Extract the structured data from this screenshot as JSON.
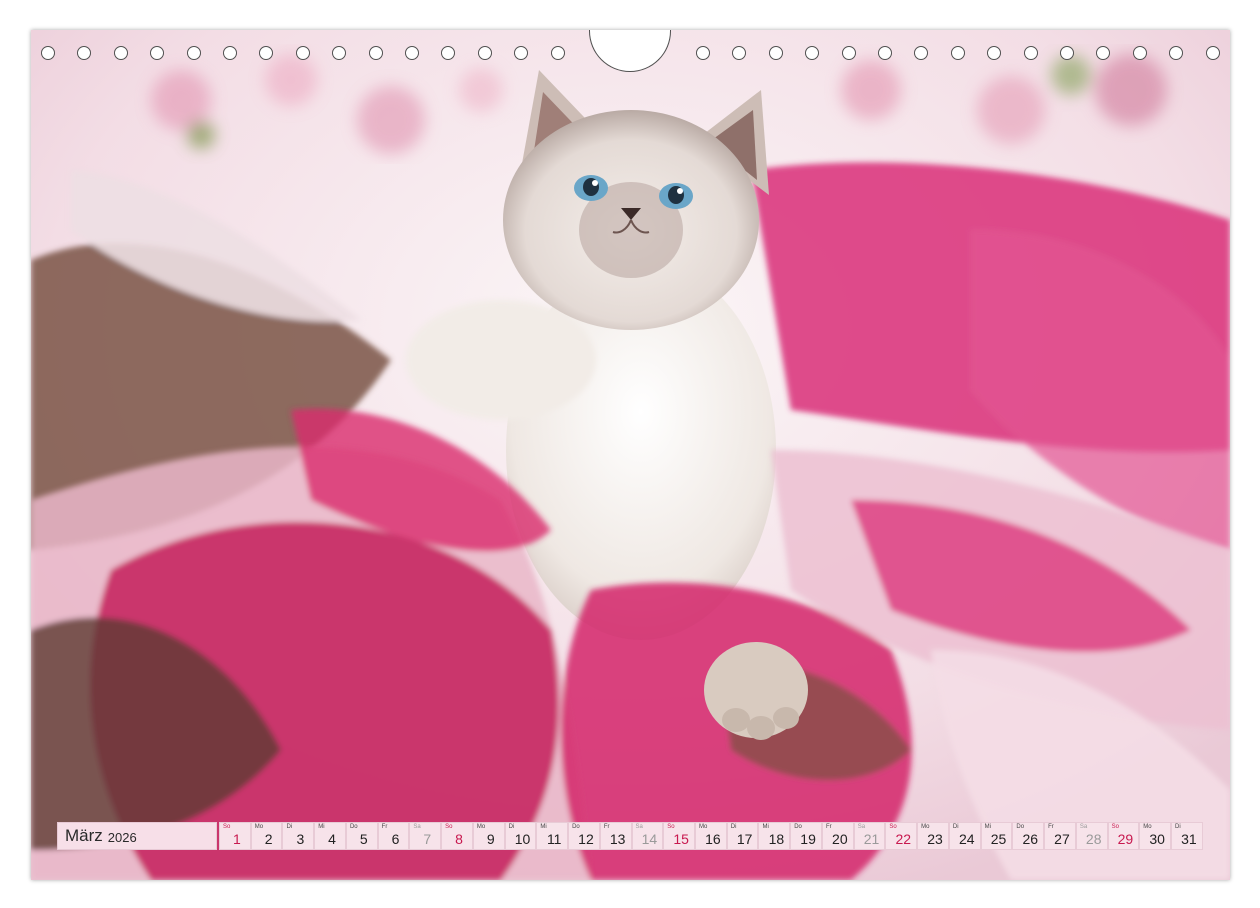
{
  "calendar": {
    "month": "März",
    "year": "2026",
    "accent_sunday": "#c8194f",
    "muted_saturday": "#9a9a9a",
    "days": [
      {
        "wd": "So",
        "n": "1",
        "t": "sun"
      },
      {
        "wd": "Mo",
        "n": "2",
        "t": ""
      },
      {
        "wd": "Di",
        "n": "3",
        "t": ""
      },
      {
        "wd": "Mi",
        "n": "4",
        "t": ""
      },
      {
        "wd": "Do",
        "n": "5",
        "t": ""
      },
      {
        "wd": "Fr",
        "n": "6",
        "t": ""
      },
      {
        "wd": "Sa",
        "n": "7",
        "t": "sat"
      },
      {
        "wd": "So",
        "n": "8",
        "t": "sun"
      },
      {
        "wd": "Mo",
        "n": "9",
        "t": ""
      },
      {
        "wd": "Di",
        "n": "10",
        "t": ""
      },
      {
        "wd": "Mi",
        "n": "11",
        "t": ""
      },
      {
        "wd": "Do",
        "n": "12",
        "t": ""
      },
      {
        "wd": "Fr",
        "n": "13",
        "t": ""
      },
      {
        "wd": "Sa",
        "n": "14",
        "t": "sat"
      },
      {
        "wd": "So",
        "n": "15",
        "t": "sun"
      },
      {
        "wd": "Mo",
        "n": "16",
        "t": ""
      },
      {
        "wd": "Di",
        "n": "17",
        "t": ""
      },
      {
        "wd": "Mi",
        "n": "18",
        "t": ""
      },
      {
        "wd": "Do",
        "n": "19",
        "t": ""
      },
      {
        "wd": "Fr",
        "n": "20",
        "t": ""
      },
      {
        "wd": "Sa",
        "n": "21",
        "t": "sat"
      },
      {
        "wd": "So",
        "n": "22",
        "t": "sun"
      },
      {
        "wd": "Mo",
        "n": "23",
        "t": ""
      },
      {
        "wd": "Di",
        "n": "24",
        "t": ""
      },
      {
        "wd": "Mi",
        "n": "25",
        "t": ""
      },
      {
        "wd": "Do",
        "n": "26",
        "t": ""
      },
      {
        "wd": "Fr",
        "n": "27",
        "t": ""
      },
      {
        "wd": "Sa",
        "n": "28",
        "t": "sat"
      },
      {
        "wd": "So",
        "n": "29",
        "t": "sun"
      },
      {
        "wd": "Mo",
        "n": "30",
        "t": ""
      },
      {
        "wd": "Di",
        "n": "31",
        "t": ""
      }
    ]
  },
  "photo": {
    "subject_icon": "kitten-in-tulle-photo",
    "tulle_pink": "#d8246e",
    "tulle_brown": "#6b4438",
    "tulle_light": "#f1c9d8",
    "fur": "#f3efea"
  }
}
